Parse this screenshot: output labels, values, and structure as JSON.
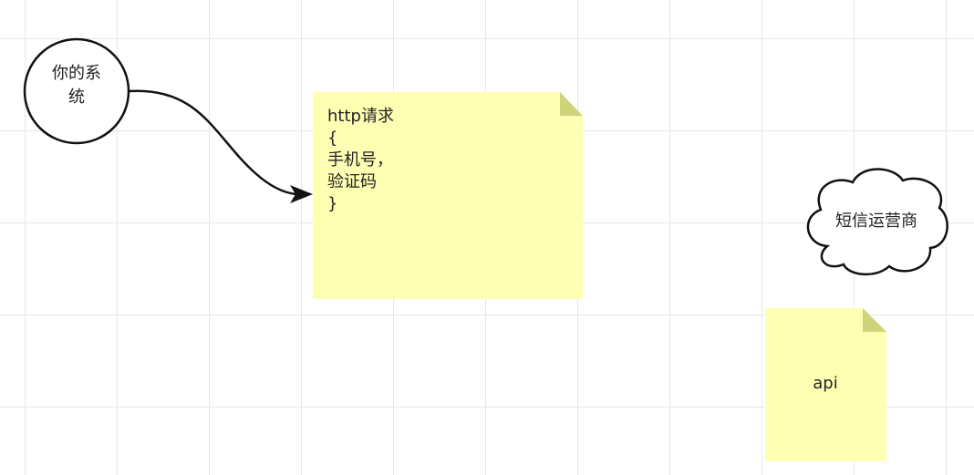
{
  "canvas": {
    "grid": true,
    "background": "#ffffff",
    "grid_color": "#e6e6e6"
  },
  "nodes": {
    "system": {
      "shape": "circle",
      "label": "你的系统"
    },
    "request_note": {
      "shape": "sticky-note",
      "lines": [
        "http请求",
        "{",
        "手机号，",
        "验证码",
        "}"
      ],
      "fill": "#ffffb3",
      "fold": "#cfd37a"
    },
    "sms_provider": {
      "shape": "cloud",
      "label": "短信运营商"
    },
    "api_note": {
      "shape": "sticky-note",
      "label": "api",
      "fill": "#ffffb3",
      "fold": "#cfd37a"
    }
  },
  "edges": [
    {
      "from": "system",
      "to": "request_note",
      "style": "curved-arrow",
      "color": "#111111"
    }
  ]
}
